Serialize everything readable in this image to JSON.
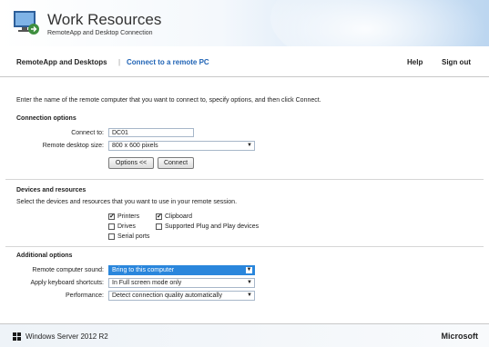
{
  "header": {
    "title": "Work Resources",
    "subtitle": "RemoteApp and Desktop Connection"
  },
  "nav": {
    "tabs": [
      "RemoteApp and Desktops",
      "Connect to a remote PC"
    ],
    "separator": "|",
    "help": "Help",
    "signout": "Sign out",
    "active_color": "#1f63b5"
  },
  "intro": "Enter the name of the remote computer that you want to connect to, specify options, and then click Connect.",
  "connection": {
    "title": "Connection options",
    "connect_label": "Connect to:",
    "connect_value": "DC01",
    "size_label": "Remote desktop size:",
    "size_value": "800 x 600 pixels",
    "options_btn": "Options <<",
    "connect_btn": "Connect"
  },
  "devices": {
    "title": "Devices and resources",
    "desc": "Select the devices and resources that you want to use in your remote session.",
    "items": [
      {
        "label": "Printers",
        "checked": true
      },
      {
        "label": "Clipboard",
        "checked": true
      },
      {
        "label": "Drives",
        "checked": false
      },
      {
        "label": "Supported Plug and Play devices",
        "checked": false
      },
      {
        "label": "Serial ports",
        "checked": false
      }
    ]
  },
  "additional": {
    "title": "Additional options",
    "sound_label": "Remote computer sound:",
    "sound_value": "Bring to this computer",
    "keyboard_label": "Apply keyboard shortcuts:",
    "keyboard_value": "In Full screen mode only",
    "performance_label": "Performance:",
    "performance_value": "Detect connection quality automatically"
  },
  "footer": {
    "product": "Windows Server 2012 R2",
    "vendor": "Microsoft"
  },
  "icons": {
    "check": "✔",
    "dropdown": "▼"
  }
}
